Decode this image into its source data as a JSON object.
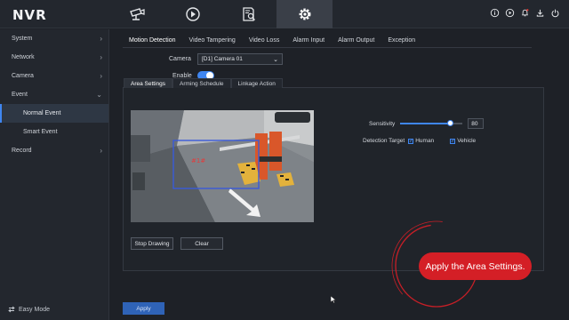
{
  "app": {
    "logo": "NVR"
  },
  "mainnav": [
    {
      "name": "live-view",
      "icon": "camera-icon"
    },
    {
      "name": "playback",
      "icon": "playback-icon"
    },
    {
      "name": "file-search",
      "icon": "file-search-icon"
    },
    {
      "name": "settings",
      "icon": "gear-icon",
      "active": true
    }
  ],
  "top_icons": [
    "info-icon",
    "play-circle-icon",
    "bell-icon",
    "download-icon",
    "power-icon"
  ],
  "sidebar": {
    "items": [
      {
        "label": "System",
        "has_children": true
      },
      {
        "label": "Network",
        "has_children": true
      },
      {
        "label": "Camera",
        "has_children": true
      },
      {
        "label": "Event",
        "expanded": true
      },
      {
        "label": "Normal Event",
        "sub": true,
        "selected": true
      },
      {
        "label": "Smart Event",
        "sub": true
      },
      {
        "label": "Record",
        "has_children": true
      }
    ],
    "easy_mode": "Easy Mode"
  },
  "subtabs": [
    "Motion Detection",
    "Video Tampering",
    "Video Loss",
    "Alarm Input",
    "Alarm Output",
    "Exception"
  ],
  "form": {
    "camera_label": "Camera",
    "camera_value": "[D1] Camera 01",
    "enable_label": "Enable",
    "enable_on": true
  },
  "panel": {
    "tabs": [
      "Area Settings",
      "Arming Schedule",
      "Linkage Action"
    ],
    "stop_drawing": "Stop Drawing",
    "clear": "Clear",
    "sensitivity_label": "Sensitivity",
    "sensitivity_value": "80",
    "sensitivity_fraction": 0.8,
    "detection_target_label": "Detection Target",
    "targets": [
      {
        "label": "Human",
        "checked": true
      },
      {
        "label": "Vehicle",
        "checked": true
      }
    ]
  },
  "video_overlay": {
    "region_label": "#1#"
  },
  "apply_label": "Apply",
  "callout": "Apply the Area Settings.",
  "colors": {
    "accent": "#3f86f1",
    "callout": "#d41f26",
    "background": "#1e2127"
  }
}
